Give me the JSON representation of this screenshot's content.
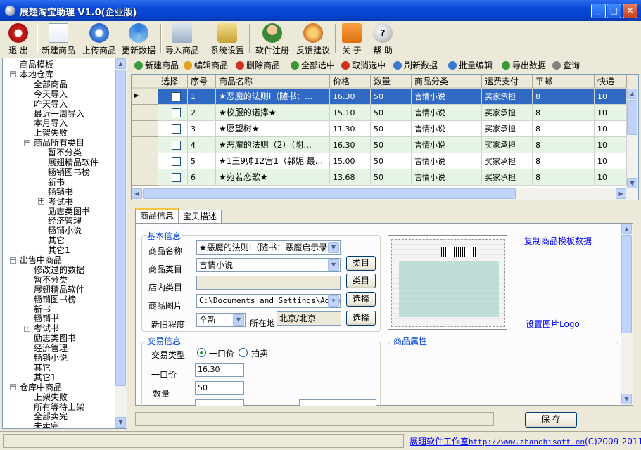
{
  "window": {
    "title": "展翅淘宝助理 V1.0(企业版)"
  },
  "toolbar": [
    {
      "label": "退 出",
      "icon": "exit-icon"
    },
    {
      "label": "新建商品",
      "icon": "new-product-icon"
    },
    {
      "label": "上传商品",
      "icon": "upload-icon"
    },
    {
      "label": "更新数据",
      "icon": "refresh-icon"
    },
    {
      "label": "导入商品",
      "icon": "import-icon"
    },
    {
      "label": "系统设置",
      "icon": "settings-icon"
    },
    {
      "label": "软件注册",
      "icon": "register-icon"
    },
    {
      "label": "反馈建议",
      "icon": "feedback-icon"
    },
    {
      "label": "关 于",
      "icon": "home-icon"
    },
    {
      "label": "帮 助",
      "icon": "help-icon"
    }
  ],
  "tree": [
    {
      "label": "商品模板",
      "depth": 0
    },
    {
      "label": "本地仓库",
      "depth": 0,
      "expander": "-"
    },
    {
      "label": "全部商品",
      "depth": 1
    },
    {
      "label": "今天导入",
      "depth": 1
    },
    {
      "label": "昨天导入",
      "depth": 1
    },
    {
      "label": "最近一周导入",
      "depth": 1
    },
    {
      "label": "本月导入",
      "depth": 1
    },
    {
      "label": "上架失败",
      "depth": 1
    },
    {
      "label": "商品所有类目",
      "depth": 1,
      "expander": "-"
    },
    {
      "label": "暂不分类",
      "depth": 2
    },
    {
      "label": "展翅精品软件",
      "depth": 2
    },
    {
      "label": "畅销图书榜",
      "depth": 2
    },
    {
      "label": "新书",
      "depth": 2
    },
    {
      "label": "畅销书",
      "depth": 2
    },
    {
      "label": "考试书",
      "depth": 2,
      "expander": "+"
    },
    {
      "label": "励志类图书",
      "depth": 2
    },
    {
      "label": "经济管理",
      "depth": 2
    },
    {
      "label": "畅销小说",
      "depth": 2
    },
    {
      "label": "其它",
      "depth": 2
    },
    {
      "label": "其它1",
      "depth": 2
    },
    {
      "label": "出售中商品",
      "depth": 0,
      "expander": "-"
    },
    {
      "label": "修改过的数据",
      "depth": 1
    },
    {
      "label": "暂不分类",
      "depth": 1
    },
    {
      "label": "展翅精品软件",
      "depth": 1
    },
    {
      "label": "畅销图书榜",
      "depth": 1
    },
    {
      "label": "新书",
      "depth": 1
    },
    {
      "label": "畅销书",
      "depth": 1
    },
    {
      "label": "考试书",
      "depth": 1,
      "expander": "+"
    },
    {
      "label": "励志类图书",
      "depth": 1
    },
    {
      "label": "经济管理",
      "depth": 1
    },
    {
      "label": "畅销小说",
      "depth": 1
    },
    {
      "label": "其它",
      "depth": 1
    },
    {
      "label": "其它1",
      "depth": 1
    },
    {
      "label": "仓库中商品",
      "depth": 0,
      "expander": "-"
    },
    {
      "label": "上架失败",
      "depth": 1
    },
    {
      "label": "所有等待上架",
      "depth": 1
    },
    {
      "label": "全部卖完",
      "depth": 1
    },
    {
      "label": "未卖完",
      "depth": 1
    }
  ],
  "grid_toolbar": [
    {
      "label": "新建商品",
      "icon": "add-icon",
      "color": "#3a9a3a"
    },
    {
      "label": "编辑商品",
      "icon": "pencil-icon",
      "color": "#e0a020"
    },
    {
      "label": "删除商品",
      "icon": "delete-icon",
      "color": "#d03020"
    },
    {
      "label": "全部选中",
      "icon": "check-all-icon",
      "color": "#3a9a3a"
    },
    {
      "label": "取消选中",
      "icon": "cancel-icon",
      "color": "#d03020"
    },
    {
      "label": "刷新数据",
      "icon": "refresh-small-icon",
      "color": "#3a7ad0"
    },
    {
      "label": "批量编辑",
      "icon": "batch-edit-icon",
      "color": "#3a7ad0"
    },
    {
      "label": "导出数据",
      "icon": "export-icon",
      "color": "#3a9a3a"
    },
    {
      "label": "查询",
      "icon": "search-icon",
      "color": "#808080"
    }
  ],
  "grid": {
    "columns": [
      "选择",
      "序号",
      "商品名称",
      "价格",
      "数量",
      "商品分类",
      "运费支付",
      "平邮",
      "快递"
    ],
    "rows": [
      {
        "idx": "1",
        "name": "★恶魔的法则Ⅰ（随书：...",
        "price": "16.30",
        "qty": "50",
        "cat": "言情小说",
        "pay": "买家承担",
        "mail": "8",
        "express": "10",
        "selected": true
      },
      {
        "idx": "2",
        "name": "★校服的诺撑★",
        "price": "15.10",
        "qty": "50",
        "cat": "言情小说",
        "pay": "买家承担",
        "mail": "8",
        "express": "10"
      },
      {
        "idx": "3",
        "name": "★愿望树★",
        "price": "11.30",
        "qty": "50",
        "cat": "言情小说",
        "pay": "买家承担",
        "mail": "8",
        "express": "10"
      },
      {
        "idx": "4",
        "name": "★恶魔的法则（2）（附...",
        "price": "16.30",
        "qty": "50",
        "cat": "言情小说",
        "pay": "买家承担",
        "mail": "8",
        "express": "10"
      },
      {
        "idx": "5",
        "name": "★1王9帅12宫1（郭妮 最...",
        "price": "15.00",
        "qty": "50",
        "cat": "言情小说",
        "pay": "买家承担",
        "mail": "8",
        "express": "10"
      },
      {
        "idx": "6",
        "name": "★宛若恋歌★",
        "price": "13.68",
        "qty": "50",
        "cat": "言情小说",
        "pay": "买家承担",
        "mail": "8",
        "express": "10"
      }
    ]
  },
  "tabs": [
    "商品信息",
    "宝贝描述"
  ],
  "form": {
    "basic_title": "基本信息",
    "name_label": "商品名称",
    "name_value": "★恶魔的法则Ⅰ（随书：恶魔启示录",
    "category_label": "商品类目",
    "category_value": "言情小说",
    "category_btn": "类目",
    "shop_category_label": "店内类目",
    "shop_category_btn": "类目",
    "image_label": "商品图片",
    "image_value": "C:\\Documents and Settings\\Admin",
    "image_btn": "选择",
    "condition_label": "新旧程度",
    "condition_value": "全新",
    "location_label": "所在地",
    "location_value": "北京/北京",
    "location_btn": "选择",
    "copy_link": "复制商品模板数据",
    "logo_link": "设置图片Logo",
    "trade_title": "交易信息",
    "trade_type_label": "交易类型",
    "opt_fixed": "一口价",
    "opt_auction": "拍卖",
    "fixed_price_label": "一口价",
    "fixed_price_value": "16.30",
    "qty_label": "数量",
    "qty_value": "50",
    "attr_title": "商品属性"
  },
  "save_btn": "保 存",
  "status": {
    "studio": "展翅软件工作室",
    "url": "http://www.zhanchisoft.cn",
    "copyright": "(C)2009-2011"
  },
  "colors": {
    "selected_row": "#316ac5",
    "alt_row": "#e6f5e6",
    "accent": "#0046d5"
  }
}
